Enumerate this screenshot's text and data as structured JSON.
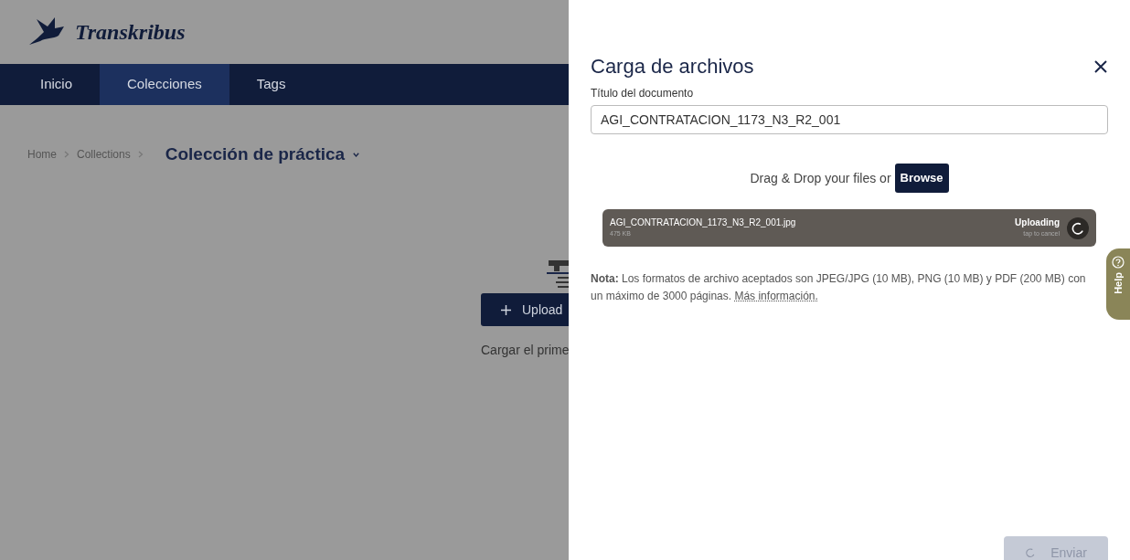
{
  "brand": {
    "name": "Transkribus"
  },
  "nav": [
    {
      "label": "Inicio",
      "selected": false
    },
    {
      "label": "Colecciones",
      "selected": true
    },
    {
      "label": "Tags",
      "selected": false
    }
  ],
  "breadcrumb": [
    "Home",
    "Collections"
  ],
  "collection_title": "Colección de práctica",
  "empty_state": {
    "button": "Upload",
    "hint": "Cargar el prime"
  },
  "dialog": {
    "title": "Carga de archivos",
    "field_label": "Título del documento",
    "field_value": "AGI_CONTRATACION_1173_N3_R2_001",
    "drop_text": "Drag & Drop your files or",
    "browse": "Browse",
    "file": {
      "name": "AGI_CONTRATACION_1173_N3_R2_001.jpg",
      "size": "475 KB",
      "status": "Uploading",
      "action": "tap to cancel"
    },
    "note": "**Nota:** Los formatos de archivo aceptados son JPEG/JPG (10 MB), PNG (10 MB) y PDF (200 MB) con un máximo de 3000 páginas.",
    "note_link": "Más información.",
    "send": {
      "label": "Enviar",
      "disabled": true
    }
  },
  "help": "Help"
}
